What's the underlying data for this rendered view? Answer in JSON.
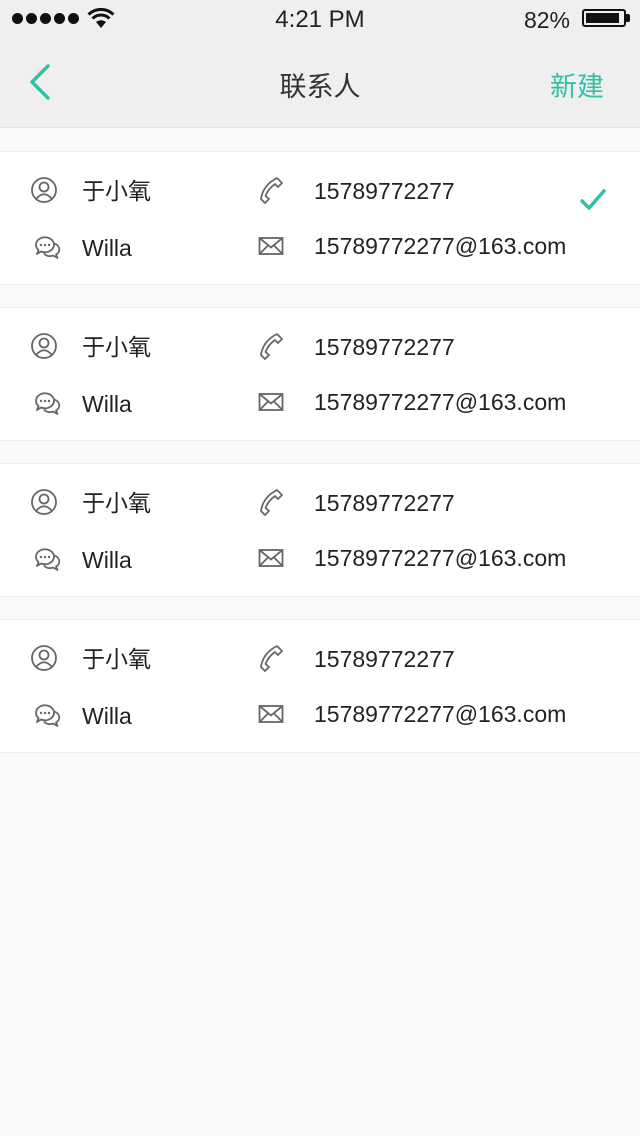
{
  "status_bar": {
    "time": "4:21 PM",
    "battery": "82%",
    "battery_level": 0.82,
    "icons": [
      "signal-dots-icon",
      "wifi-icon",
      "battery-icon"
    ]
  },
  "nav": {
    "title": "联系人",
    "action_label": "新建",
    "back_icon": "chevron-left-icon"
  },
  "colors": {
    "accent": "#33bfa6",
    "nav_background": "#efefef",
    "page_background": "#f9f9f9",
    "card_background": "#ffffff"
  },
  "contacts": [
    {
      "name": "于小氧",
      "nickname": "Willa",
      "phone": "15789772277",
      "email": "15789772277@163.com",
      "selected": true
    },
    {
      "name": "于小氧",
      "nickname": "Willa",
      "phone": "15789772277",
      "email": "15789772277@163.com",
      "selected": false
    },
    {
      "name": "于小氧",
      "nickname": "Willa",
      "phone": "15789772277",
      "email": "15789772277@163.com",
      "selected": false
    },
    {
      "name": "于小氧",
      "nickname": "Willa",
      "phone": "15789772277",
      "email": "15789772277@163.com",
      "selected": false
    }
  ],
  "contact_icons": [
    "user-icon",
    "chat-icon",
    "phone-icon",
    "mail-icon",
    "checkmark-icon"
  ]
}
